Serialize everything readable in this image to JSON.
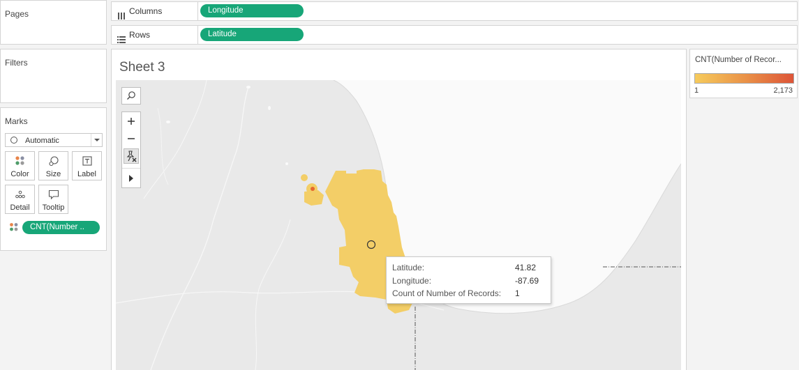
{
  "pages": {
    "title": "Pages"
  },
  "filters": {
    "title": "Filters"
  },
  "marks": {
    "title": "Marks",
    "mark_type": "Automatic",
    "buttons": {
      "color": "Color",
      "size": "Size",
      "label": "Label",
      "detail": "Detail",
      "tooltip": "Tooltip"
    },
    "field_pill": "CNT(Number .."
  },
  "shelves": {
    "columns": {
      "label": "Columns",
      "pill": "Longitude"
    },
    "rows": {
      "label": "Rows",
      "pill": "Latitude"
    }
  },
  "sheet": {
    "title": "Sheet 3"
  },
  "legend": {
    "title": "CNT(Number of Recor...",
    "min": "1",
    "max": "2,173",
    "color_low": "#f6cb5c",
    "color_high": "#dd5538"
  },
  "tooltip": {
    "rows": [
      {
        "key": "Latitude:",
        "value": "41.82"
      },
      {
        "key": "Longitude:",
        "value": "-87.69"
      },
      {
        "key": "Count of Number of Records:",
        "value": "1"
      }
    ]
  },
  "colors": {
    "accent_pill": "#17a678",
    "mark_fill": "#f3ce67"
  }
}
